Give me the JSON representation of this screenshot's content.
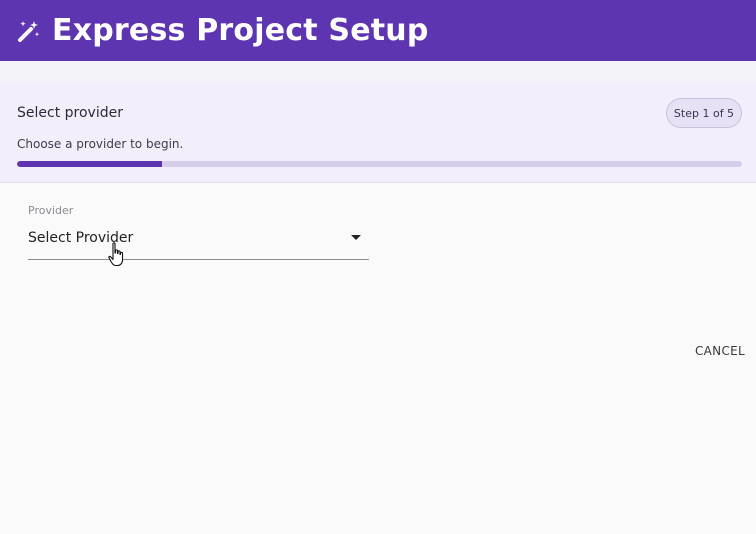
{
  "header": {
    "title": "Express Project Setup",
    "icon": "magic-wand-icon",
    "color": "#5e35b1"
  },
  "step": {
    "title": "Select provider",
    "description": "Choose a provider to begin.",
    "chip_label": "Step 1 of 5",
    "progress_fraction": 0.2
  },
  "form": {
    "provider": {
      "label": "Provider",
      "value": "Select Provider"
    }
  },
  "actions": {
    "cancel_label": "CANCEL"
  }
}
